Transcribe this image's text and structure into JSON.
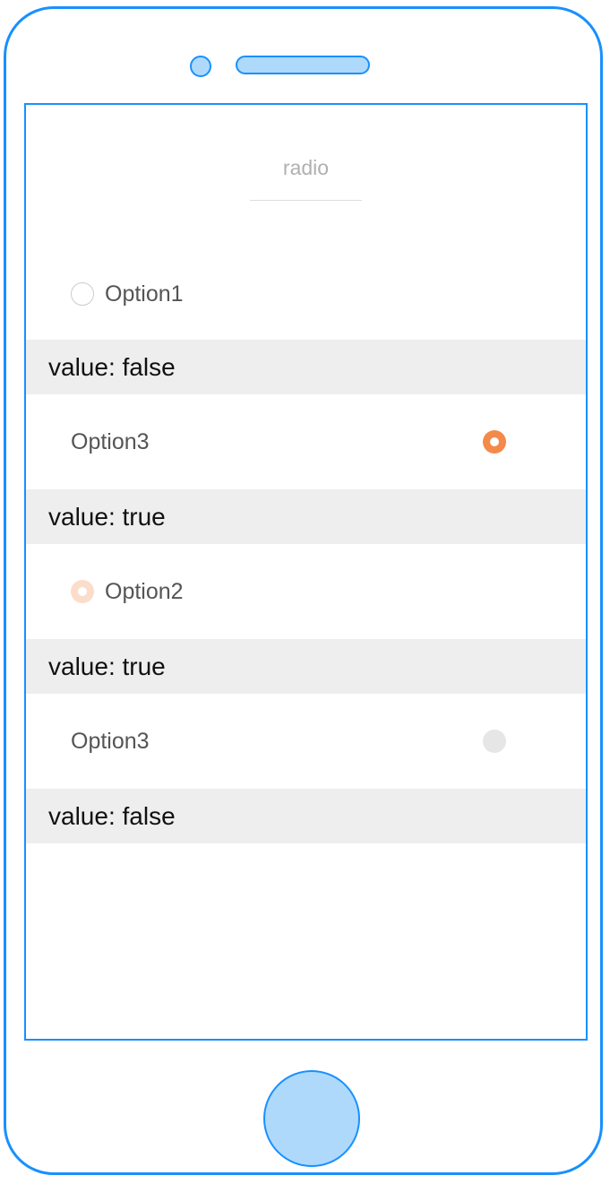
{
  "nav": {
    "title": "radio"
  },
  "rows": [
    {
      "label": "Option1",
      "state": "unchecked",
      "value_text": "value: false"
    },
    {
      "label": "Option3",
      "state": "checked",
      "value_text": "value: true"
    },
    {
      "label": "Option2",
      "state": "checked-disabled",
      "value_text": "value: true"
    },
    {
      "label": "Option3",
      "state": "unchecked-disabled",
      "value_text": "value: false"
    }
  ],
  "colors": {
    "device_outline": "#1890ff",
    "device_fill": "#aed9fb",
    "radio_checked": "#f4894a",
    "radio_checked_disabled": "#fbddcb",
    "radio_unchecked_disabled": "#e6e6e6",
    "value_bar_bg": "#eeeeee"
  }
}
